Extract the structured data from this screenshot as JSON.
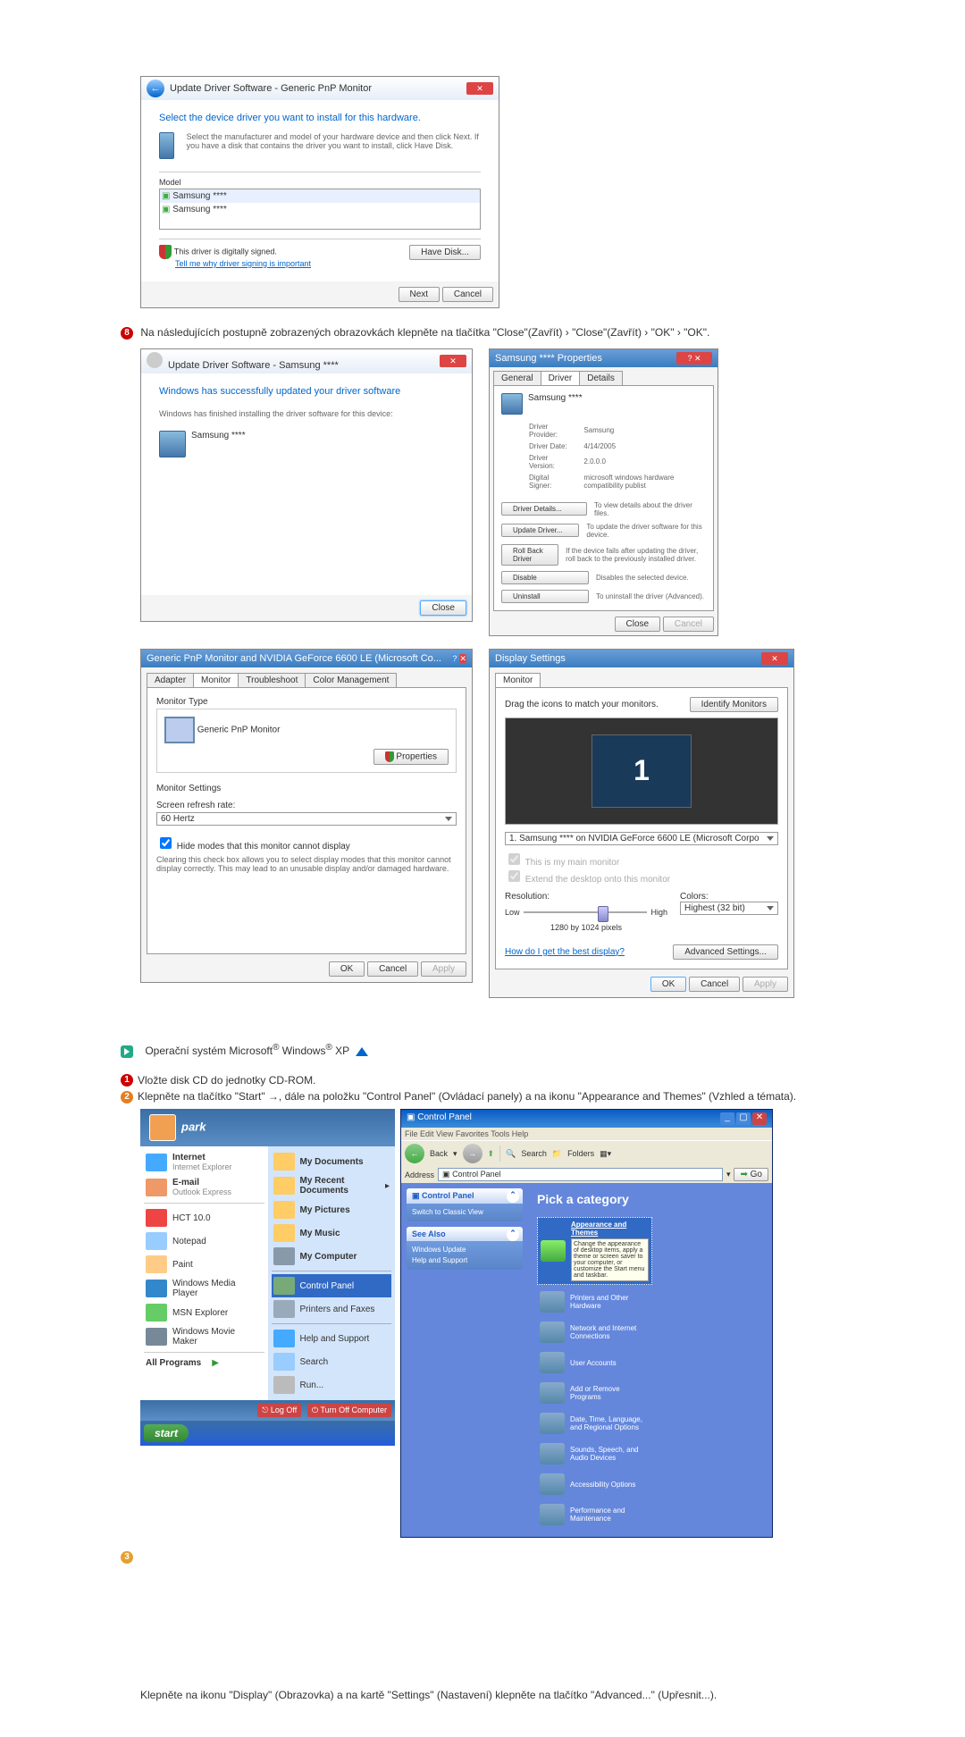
{
  "dlg1": {
    "title": "Update Driver Software - Generic PnP Monitor",
    "heading": "Select the device driver you want to install for this hardware.",
    "desc": "Select the manufacturer and model of your hardware device and then click Next. If you have a disk that contains the driver you want to install, click Have Disk.",
    "model_label": "Model",
    "model1": "Samsung ****",
    "model2": "Samsung ****",
    "signed": "This driver is digitally signed.",
    "tell_me": "Tell me why driver signing is important",
    "have_disk": "Have Disk...",
    "next": "Next",
    "cancel": "Cancel"
  },
  "step8": "Na následujících postupně zobrazených obrazovkách klepněte na tlačítka \"Close\"(Zavřít) › \"Close\"(Zavřít) › \"OK\" › \"OK\".",
  "dlg2": {
    "title": "Update Driver Software - Samsung ****",
    "heading": "Windows has successfully updated your driver software",
    "desc": "Windows has finished installing the driver software for this device:",
    "device": "Samsung ****",
    "close": "Close"
  },
  "dlg3": {
    "title": "Samsung **** Properties",
    "tab_general": "General",
    "tab_driver": "Driver",
    "tab_details": "Details",
    "device": "Samsung ****",
    "provider_l": "Driver Provider:",
    "provider": "Samsung",
    "date_l": "Driver Date:",
    "date": "4/14/2005",
    "version_l": "Driver Version:",
    "version": "2.0.0.0",
    "signer_l": "Digital Signer:",
    "signer": "microsoft windows hardware compatibility publist",
    "btn_details": "Driver Details...",
    "btn_details_d": "To view details about the driver files.",
    "btn_update": "Update Driver...",
    "btn_update_d": "To update the driver software for this device.",
    "btn_rollback": "Roll Back Driver",
    "btn_rollback_d": "If the device fails after updating the driver, roll back to the previously installed driver.",
    "btn_disable": "Disable",
    "btn_disable_d": "Disables the selected device.",
    "btn_uninstall": "Uninstall",
    "btn_uninstall_d": "To uninstall the driver (Advanced).",
    "close": "Close",
    "cancel": "Cancel"
  },
  "dlg4": {
    "title": "Generic PnP Monitor and NVIDIA GeForce 6600 LE (Microsoft Co...",
    "tab1": "Adapter",
    "tab2": "Monitor",
    "tab3": "Troubleshoot",
    "tab4": "Color Management",
    "mtype": "Monitor Type",
    "mname": "Generic PnP Monitor",
    "props": "Properties",
    "settings": "Monitor Settings",
    "refresh_l": "Screen refresh rate:",
    "refresh": "60 Hertz",
    "hide": "Hide modes that this monitor cannot display",
    "hide_d": "Clearing this check box allows you to select display modes that this monitor cannot display correctly. This may lead to an unusable display and/or damaged hardware.",
    "ok": "OK",
    "cancel": "Cancel",
    "apply": "Apply"
  },
  "dlg5": {
    "title": "Display Settings",
    "tab": "Monitor",
    "drag": "Drag the icons to match your monitors.",
    "identify": "Identify Monitors",
    "mon_num": "1",
    "selected": "1. Samsung **** on NVIDIA GeForce 6600 LE (Microsoft Corpo",
    "main": "This is my main monitor",
    "extend": "Extend the desktop onto this monitor",
    "res_l": "Resolution:",
    "low": "Low",
    "high": "High",
    "res_v": "1280 by 1024 pixels",
    "colors_l": "Colors:",
    "colors_v": "Highest (32 bit)",
    "best": "How do I get the best display?",
    "adv": "Advanced Settings...",
    "ok": "OK",
    "cancel": "Cancel",
    "apply": "Apply"
  },
  "xp_heading": "Operační systém Microsoft",
  "xp_heading2": " Windows",
  "xp_heading3": " XP",
  "step1": "Vložte disk CD do jednotky CD-ROM.",
  "step2": "Klepněte na tlačítko \"Start\" →, dále na položku \"Control Panel\" (Ovládací panely) a na ikonu \"Appearance and Themes\" (Vzhled a témata).",
  "start": {
    "user": "park",
    "left": [
      "Internet",
      "E-mail",
      "HCT 10.0",
      "Notepad",
      "Paint",
      "Windows Media Player",
      "MSN Explorer",
      "Windows Movie Maker"
    ],
    "left_sub": [
      "Internet Explorer",
      "Outlook Express"
    ],
    "right": [
      "My Documents",
      "My Recent Documents",
      "My Pictures",
      "My Music",
      "My Computer",
      "Control Panel",
      "Printers and Faxes",
      "Help and Support",
      "Search",
      "Run..."
    ],
    "all": "All Programs",
    "logoff": "Log Off",
    "turnoff": "Turn Off Computer",
    "start_btn": "start"
  },
  "cp": {
    "title": "Control Panel",
    "menu": "File   Edit   View   Favorites   Tools   Help",
    "back": "Back",
    "search": "Search",
    "folders": "Folders",
    "addr_l": "Address",
    "addr": "Control Panel",
    "go": "Go",
    "side1_h": "Control Panel",
    "side1_i": "Switch to Classic View",
    "side2_h": "See Also",
    "side2_i1": "Windows Update",
    "side2_i2": "Help and Support",
    "pick": "Pick a category",
    "cats": [
      "Appearance and Themes",
      "Printers and Other Hardware",
      "Network and Internet Connections",
      "User Accounts",
      "Add or Remove Programs",
      "Date, Time, Language, and Regional Options",
      "Sounds, Speech, and Audio Devices",
      "Accessibility Options",
      "Performance and Maintenance"
    ],
    "cat_desc": "Change the appearance of desktop items, apply a theme or screen saver to your computer, or customize the Start menu and taskbar."
  },
  "step_last": "Klepněte na ikonu \"Display\" (Obrazovka) a na kartě \"Settings\" (Nastavení) klepněte na tlačítko \"Advanced...\" (Upřesnit...)."
}
